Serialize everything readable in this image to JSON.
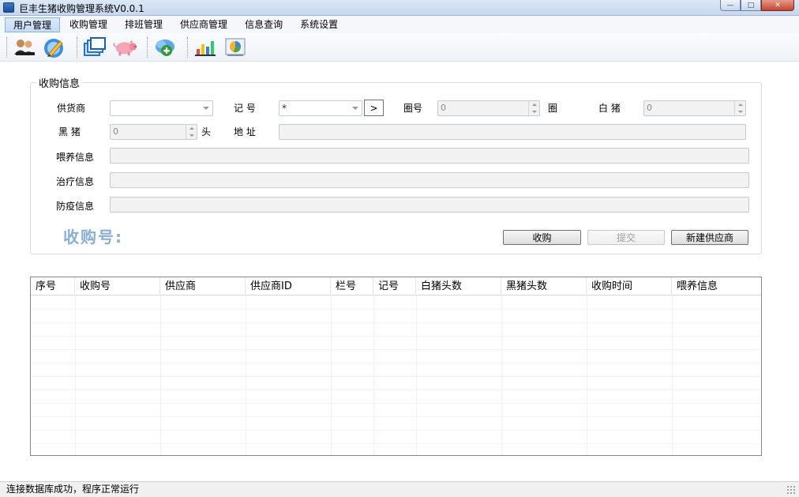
{
  "window": {
    "title": "巨丰生猪收购管理系统V0.0.1",
    "minimize": "—",
    "maximize": "□",
    "close": "✕"
  },
  "menu": [
    {
      "label": "用户管理",
      "active": true
    },
    {
      "label": "收购管理"
    },
    {
      "label": "排班管理"
    },
    {
      "label": "供应商管理"
    },
    {
      "label": "信息查询"
    },
    {
      "label": "系统设置"
    }
  ],
  "toolbar_icons": [
    "users-icon",
    "edit-icon",
    "windows-icon",
    "pig-icon",
    "cloud-add-icon",
    "bar-chart-icon",
    "pie-chart-icon"
  ],
  "group": {
    "title": "收购信息",
    "supplier_label": "供货商",
    "supplier_value": "",
    "mark_label": "记  号",
    "mark_value": "*",
    "arrow_button": ">",
    "pen_label": "圈号",
    "pen_value": "0",
    "pen_unit": "圈",
    "white_pig_label": "白  猪",
    "white_pig_value": "0",
    "black_pig_label": "黑  猪",
    "black_pig_value": "0",
    "black_pig_unit": "头",
    "address_label": "地  址",
    "address_value": "",
    "feeding_label": "喂养信息",
    "feeding_value": "",
    "treatment_label": "治疗信息",
    "treatment_value": "",
    "epidemic_label": "防疫信息",
    "epidemic_value": "",
    "purchase_no_label": "收购号:",
    "buy_button": "收购",
    "submit_button": "提交",
    "new_supplier_button": "新建供应商"
  },
  "grid": {
    "columns": [
      "序号",
      "收购号",
      "供应商",
      "供应商ID",
      "栏号",
      "记号",
      "白猪头数",
      "黑猪头数",
      "收购时间",
      "喂养信息"
    ],
    "rows": []
  },
  "status": {
    "text": "连接数据库成功，程序正常运行"
  },
  "colors": {
    "purchase_no_text": "#8aaed4",
    "menu_active_bg": "#c5dbf5"
  }
}
